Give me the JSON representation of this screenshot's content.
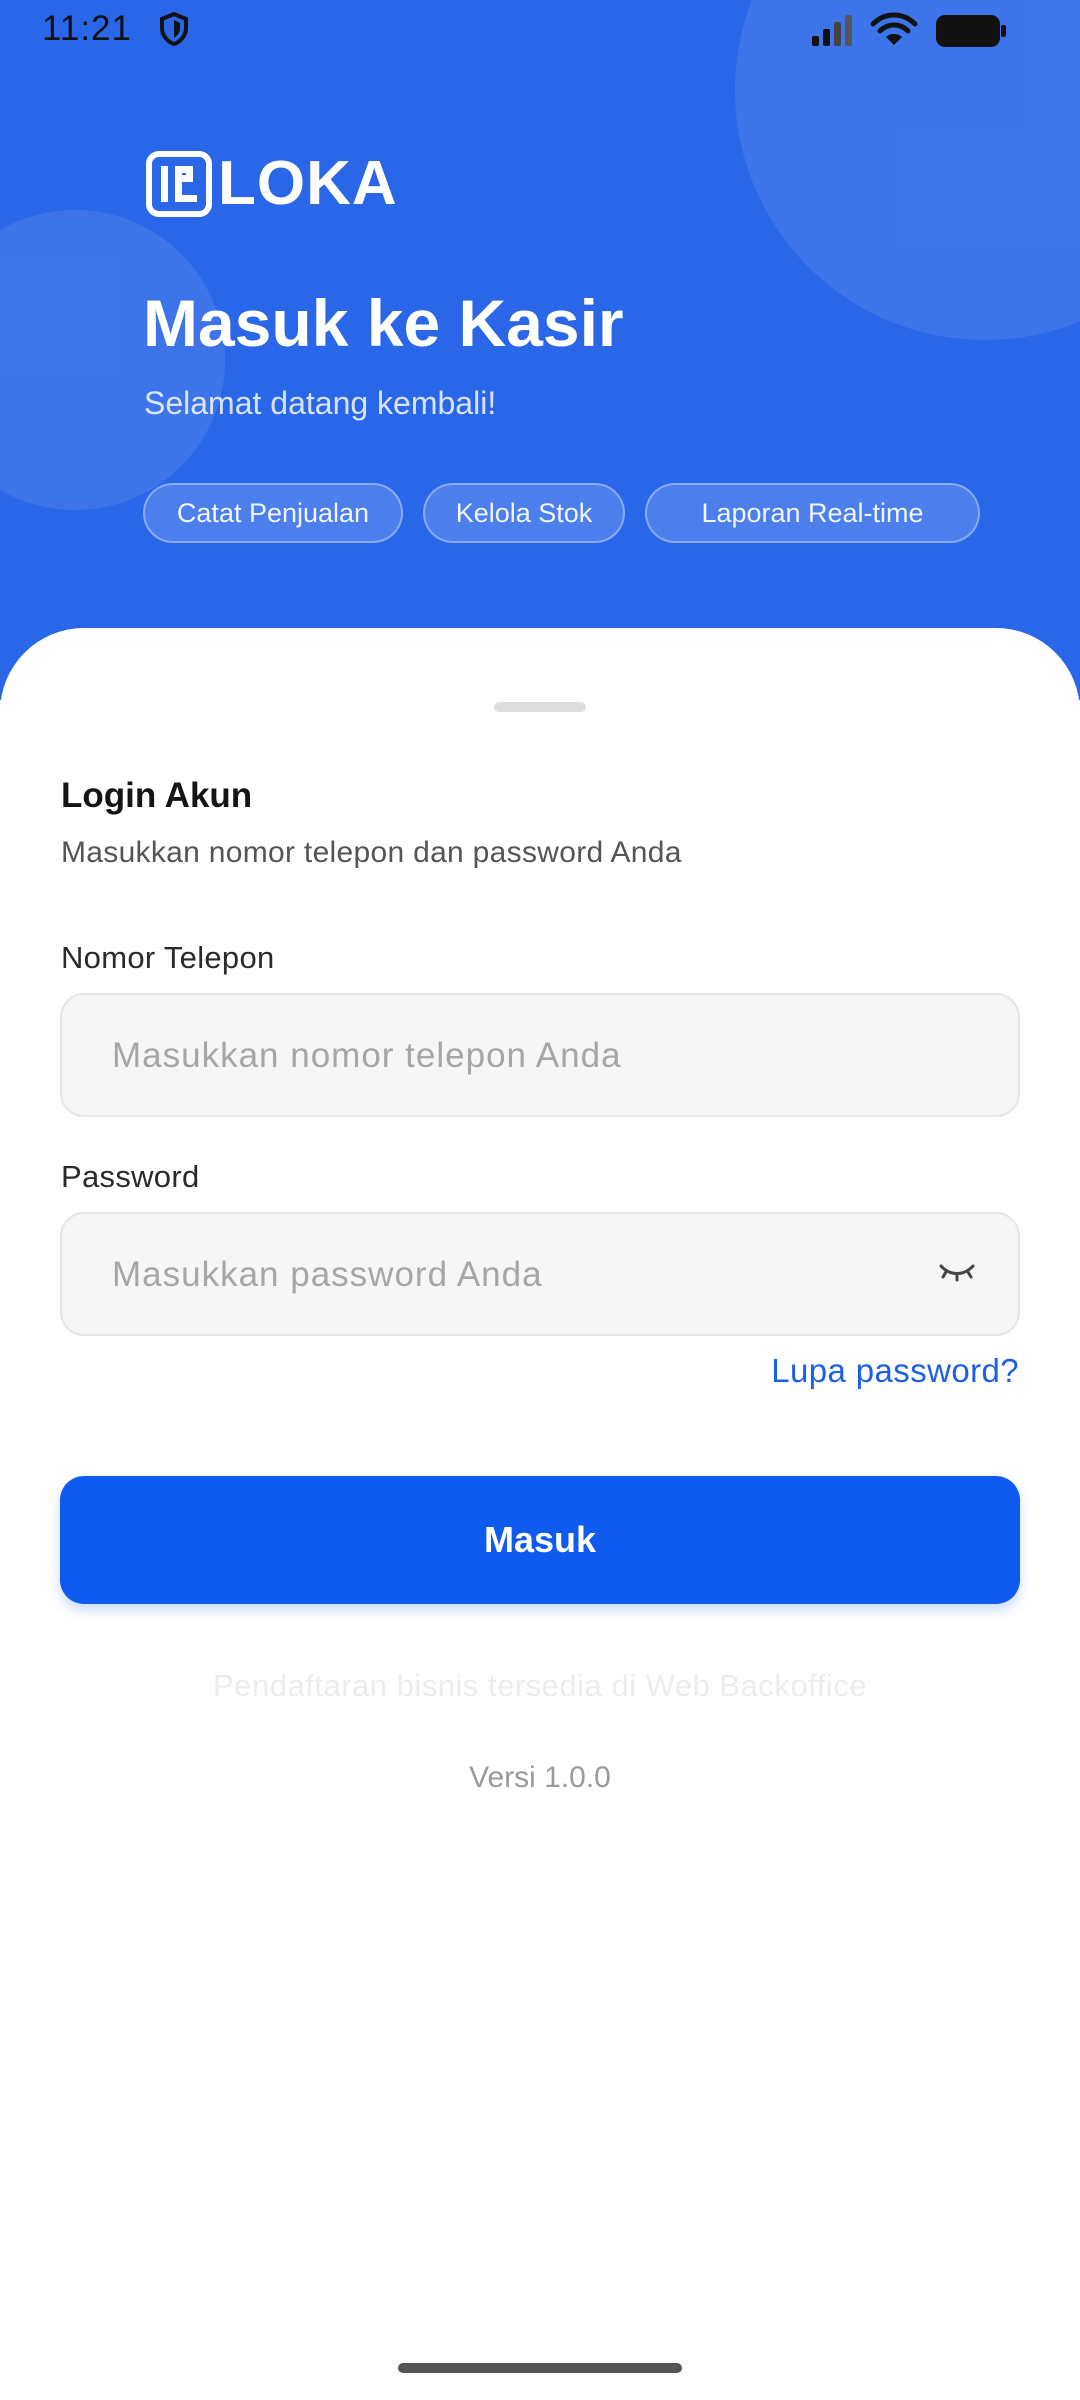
{
  "status_bar": {
    "time": "11:21",
    "icons": [
      "shield-icon",
      "signal-icon",
      "wifi-icon",
      "battery-icon"
    ]
  },
  "header": {
    "logo_text": "LOKA",
    "title": "Masuk ke Kasir",
    "subtitle": "Selamat datang kembali!",
    "chips": [
      "Catat Penjualan",
      "Kelola Stok",
      "Laporan Real-time"
    ]
  },
  "form": {
    "title": "Login Akun",
    "subtitle": "Masukkan nomor telepon dan password Anda",
    "phone": {
      "label": "Nomor Telepon",
      "value": "",
      "placeholder": "Masukkan nomor telepon Anda"
    },
    "password": {
      "label": "Password",
      "value": "",
      "placeholder": "Masukkan password Anda"
    },
    "forgot_label": "Lupa password?",
    "submit_label": "Masuk"
  },
  "footer": {
    "register_note": "Pendaftaran bisnis tersedia di Web Backoffice",
    "version": "Versi 1.0.0"
  },
  "colors": {
    "hero_bg": "#2a67e8",
    "primary": "#0f5bf0",
    "link": "#1d5fe6"
  }
}
